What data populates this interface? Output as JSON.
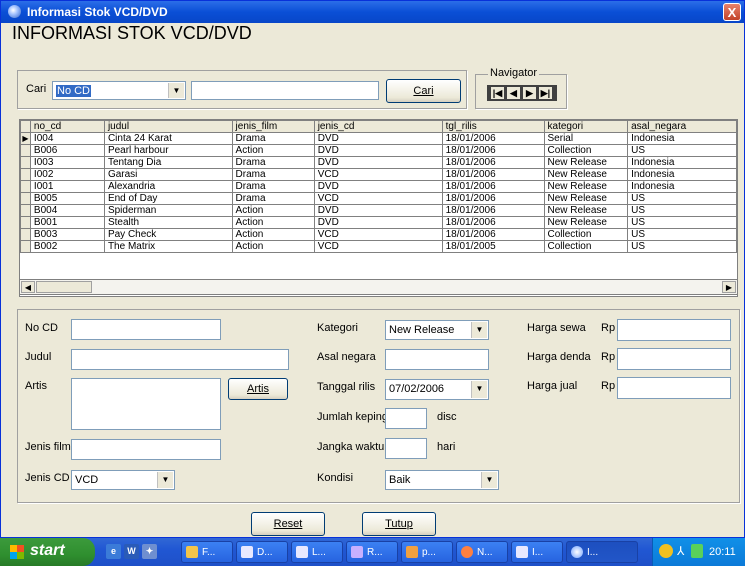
{
  "window": {
    "title": "Informasi Stok VCD/DVD",
    "close": "X"
  },
  "heading": "INFORMASI STOK VCD/DVD",
  "search": {
    "label": "Cari",
    "field_value": "No CD",
    "text_value": "",
    "button": "Cari"
  },
  "navigator": {
    "legend": "Navigator",
    "first": "|◀",
    "prev": "◀",
    "next": "▶",
    "last": "▶|"
  },
  "grid": {
    "columns": [
      "no_cd",
      "judul",
      "jenis_film",
      "jenis_cd",
      "tgl_rilis",
      "kategori",
      "asal_negara"
    ],
    "rows": [
      [
        "I004",
        "Cinta 24 Karat",
        "Drama",
        "DVD",
        "18/01/2006",
        "Serial",
        "Indonesia"
      ],
      [
        "B006",
        "Pearl harbour",
        "Action",
        "DVD",
        "18/01/2006",
        "Collection",
        "US"
      ],
      [
        "I003",
        "Tentang Dia",
        "Drama",
        "DVD",
        "18/01/2006",
        "New Release",
        "Indonesia"
      ],
      [
        "I002",
        "Garasi",
        "Drama",
        "VCD",
        "18/01/2006",
        "New Release",
        "Indonesia"
      ],
      [
        "I001",
        "Alexandria",
        "Drama",
        "DVD",
        "18/01/2006",
        "New Release",
        "Indonesia"
      ],
      [
        "B005",
        "End of Day",
        "Drama",
        "VCD",
        "18/01/2006",
        "New Release",
        "US"
      ],
      [
        "B004",
        "Spiderman",
        "Action",
        "DVD",
        "18/01/2006",
        "New Release",
        "US"
      ],
      [
        "B001",
        "Stealth",
        "Action",
        "DVD",
        "18/01/2006",
        "New Release",
        "US"
      ],
      [
        "B003",
        "Pay Check",
        "Action",
        "VCD",
        "18/01/2006",
        "Collection",
        "US"
      ],
      [
        "B002",
        "The Matrix",
        "Action",
        "VCD",
        "18/01/2005",
        "Collection",
        "US"
      ]
    ]
  },
  "form": {
    "no_cd_label": "No CD",
    "judul_label": "Judul",
    "artis_label": "Artis",
    "artis_button": "Artis",
    "jenis_film_label": "Jenis film",
    "jenis_cd_label": "Jenis CD",
    "jenis_cd_value": "VCD",
    "kategori_label": "Kategori",
    "kategori_value": "New Release",
    "asal_negara_label": "Asal negara",
    "tanggal_rilis_label": "Tanggal rilis",
    "tanggal_rilis_value": "07/02/2006",
    "jumlah_keping_label": "Jumlah keping",
    "jumlah_keping_unit": "disc",
    "jangka_waktu_label": "Jangka waktu",
    "jangka_waktu_unit": "hari",
    "kondisi_label": "Kondisi",
    "kondisi_value": "Baik",
    "harga_sewa_label": "Harga sewa",
    "harga_denda_label": "Harga denda",
    "harga_jual_label": "Harga jual",
    "currency": "Rp"
  },
  "buttons": {
    "reset": "Reset",
    "tutup": "Tutup"
  },
  "taskbar": {
    "start": "start",
    "tasks": [
      "F...",
      "D...",
      "L...",
      "R...",
      "p...",
      "N...",
      "I...",
      "I..."
    ],
    "clock": "20:11"
  },
  "colors": {
    "titlebar": "#0a4fd6",
    "window_bg": "#ece9d8",
    "start_green": "#2f8f2f",
    "taskbar_blue": "#2157d3"
  }
}
